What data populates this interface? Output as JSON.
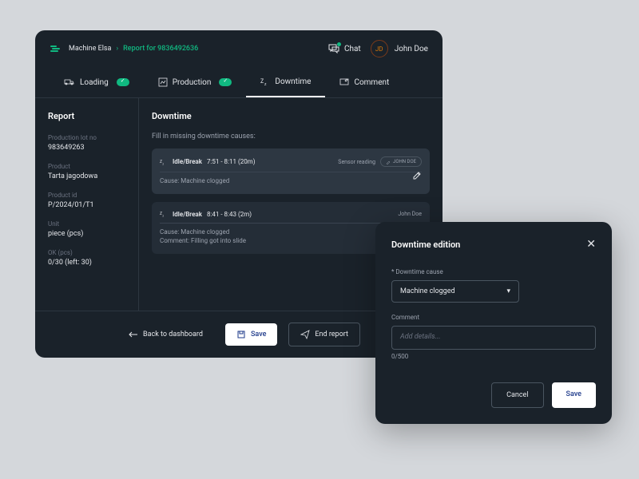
{
  "header": {
    "machine_name": "Machine Elsa",
    "report_label": "Report for 9836492636",
    "chat_label": "Chat",
    "user_initials": "JD",
    "user_name": "John Doe"
  },
  "tabs": {
    "loading": "Loading",
    "production": "Production",
    "downtime": "Downtime",
    "comment": "Comment"
  },
  "sidebar": {
    "title": "Report",
    "fields": {
      "lot_label": "Production lot no",
      "lot_value": "983649263",
      "product_label": "Product",
      "product_value": "Tarta jagodowa",
      "product_id_label": "Product id",
      "product_id_value": "P/2024/01/T1",
      "unit_label": "Unit",
      "unit_value": "piece (pcs)",
      "ok_label": "OK (pcs)",
      "ok_value": "0/30 (left: 30)"
    }
  },
  "main": {
    "title": "Downtime",
    "subtitle": "Fill in missing downtime causes:",
    "cards": [
      {
        "type": "Idle/Break",
        "time": "7:51 - 8:11 (20m)",
        "meta": "Sensor reading",
        "user": "JOHN DOE",
        "cause": "Cause: Machine clogged"
      },
      {
        "type": "Idle/Break",
        "time": "8:41 - 8:43 (2m)",
        "user": "John Doe",
        "cause": "Cause: Machine clogged",
        "comment": "Comment: Filling got into slide"
      }
    ]
  },
  "footer": {
    "back": "Back to dashboard",
    "save": "Save",
    "end": "End report"
  },
  "modal": {
    "title": "Downtime edition",
    "cause_label": "* Downtime cause",
    "cause_value": "Machine clogged",
    "comment_label": "Comment",
    "comment_placeholder": "Add details...",
    "char_count": "0/500",
    "cancel": "Cancel",
    "save": "Save"
  }
}
